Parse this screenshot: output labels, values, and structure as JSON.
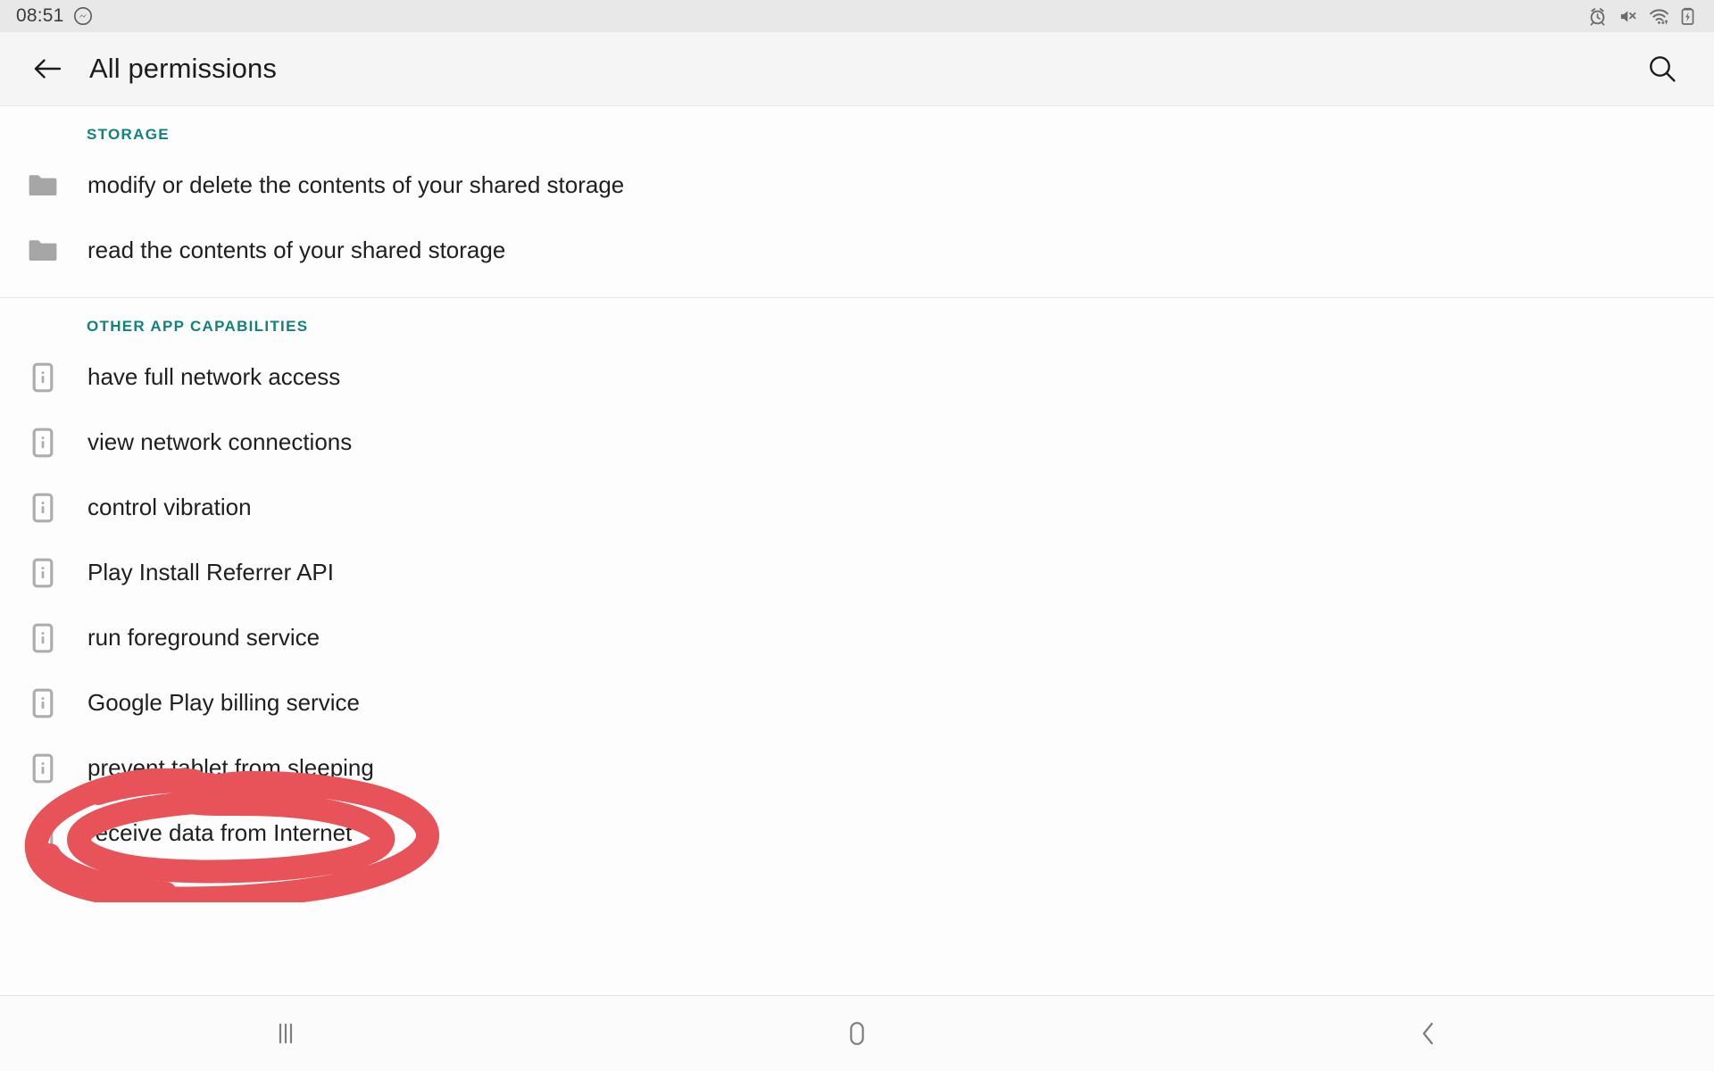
{
  "status_bar": {
    "clock": "08:51",
    "left_icons": [
      {
        "name": "messenger-icon"
      }
    ],
    "right_icons": [
      {
        "name": "alarm-icon"
      },
      {
        "name": "mute-icon"
      },
      {
        "name": "wifi-icon"
      },
      {
        "name": "battery-charging-icon"
      }
    ]
  },
  "app_bar": {
    "back_label": "back-arrow",
    "title": "All permissions",
    "search_label": "search"
  },
  "sections": [
    {
      "header": "STORAGE",
      "icon": "folder-icon",
      "items": [
        {
          "label": "modify or delete the contents of your shared storage"
        },
        {
          "label": "read the contents of your shared storage"
        }
      ]
    },
    {
      "header": "OTHER APP CAPABILITIES",
      "icon": "device-info-icon",
      "items": [
        {
          "label": "have full network access"
        },
        {
          "label": "view network connections"
        },
        {
          "label": "control vibration"
        },
        {
          "label": "Play Install Referrer API"
        },
        {
          "label": "run foreground service"
        },
        {
          "label": "Google Play billing service"
        },
        {
          "label": "prevent tablet from sleeping"
        },
        {
          "label": "receive data from Internet"
        }
      ]
    }
  ],
  "annotation": {
    "target_label": "run foreground service",
    "color": "#e8535a",
    "shape": "hand-drawn-ellipse"
  },
  "nav_bar": {
    "buttons": [
      {
        "name": "recents-button"
      },
      {
        "name": "home-button"
      },
      {
        "name": "back-button"
      }
    ]
  },
  "colors": {
    "section_header": "#12827a",
    "icon_gray": "#9e9e9e",
    "text": "#1f1f1f",
    "annotation_red": "#e8535a"
  }
}
